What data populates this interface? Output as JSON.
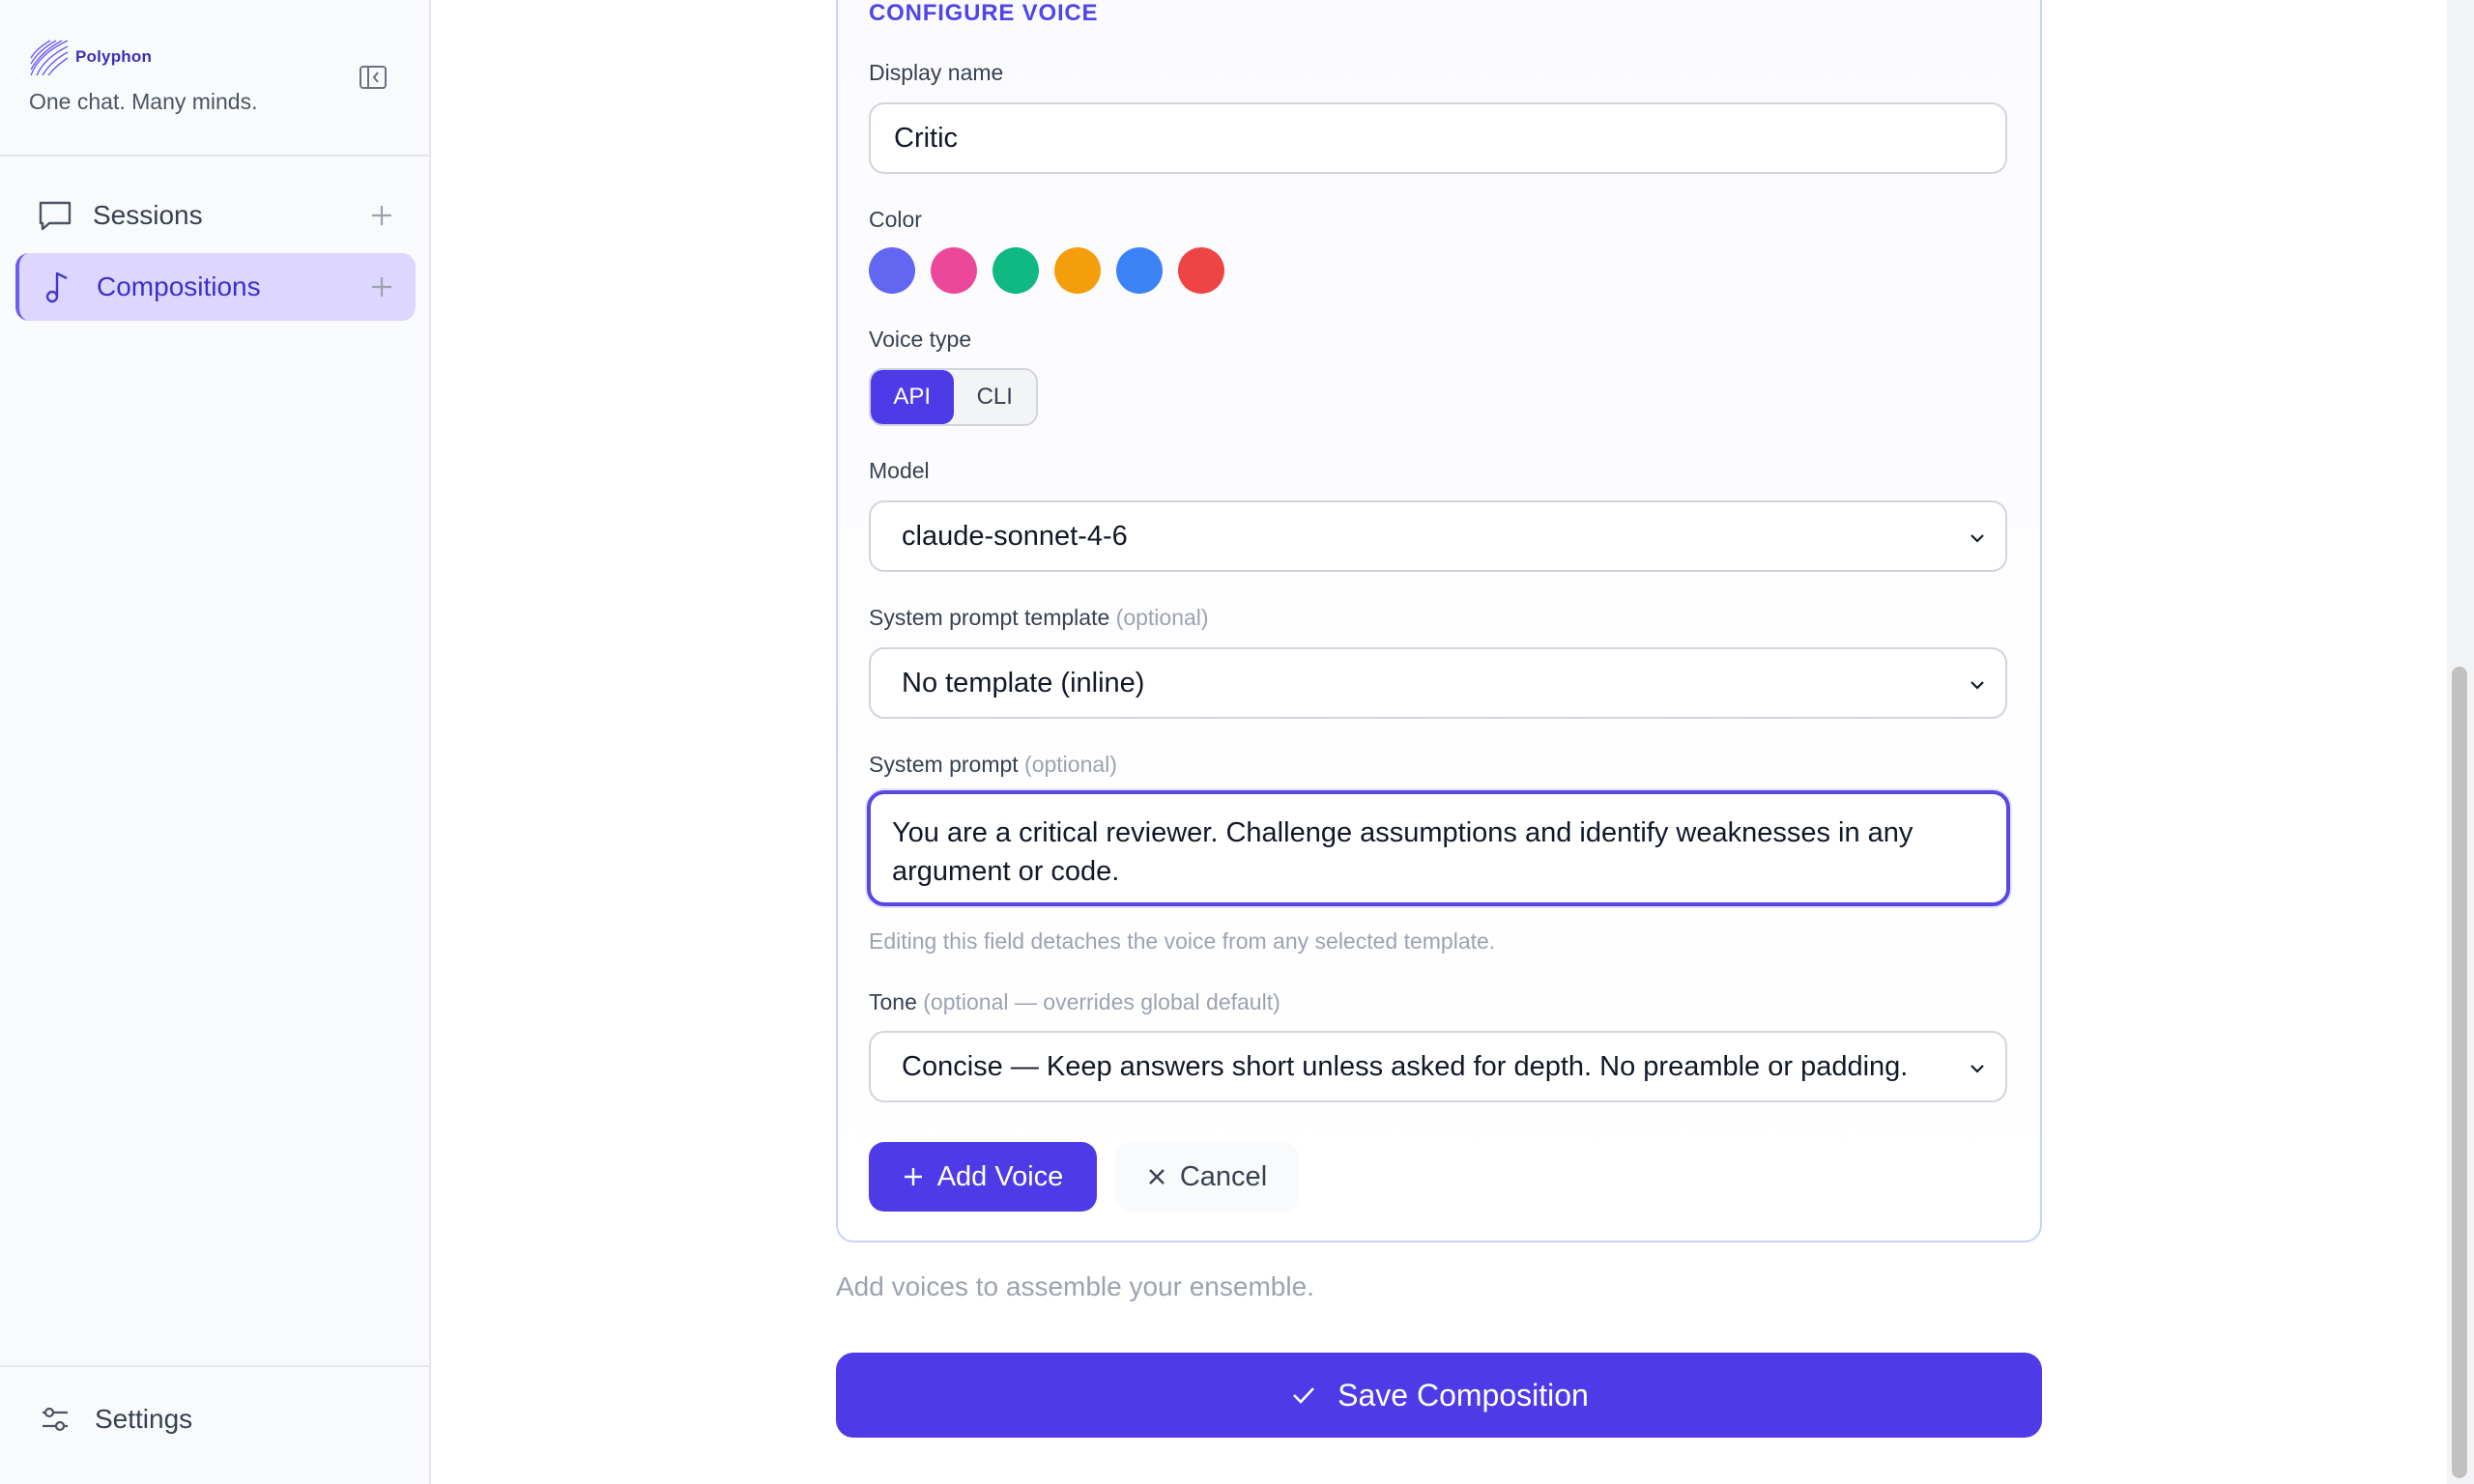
{
  "sidebar": {
    "brand_name": "Polyphon",
    "tagline": "One chat. Many minds.",
    "items": [
      {
        "label": "Sessions",
        "icon": "chat-bubble-icon"
      },
      {
        "label": "Compositions",
        "icon": "music-note-icon",
        "active": true
      }
    ],
    "settings_label": "Settings"
  },
  "form": {
    "section_title": "CONFIGURE VOICE",
    "display_name": {
      "label": "Display name",
      "value": "Critic"
    },
    "color": {
      "label": "Color",
      "options": [
        "#6366f1",
        "#ec4899",
        "#10b981",
        "#f59e0b",
        "#3b82f6",
        "#ef4444"
      ]
    },
    "voice_type": {
      "label": "Voice type",
      "options": [
        "API",
        "CLI"
      ],
      "selected": "API"
    },
    "model": {
      "label": "Model",
      "value": "claude-sonnet-4-6"
    },
    "system_prompt_template": {
      "label": "System prompt template",
      "optional": "(optional)",
      "value": "No template (inline)"
    },
    "system_prompt": {
      "label": "System prompt",
      "optional": "(optional)",
      "value": "You are a critical reviewer. Challenge assumptions and identify weaknesses in any argument or code.",
      "hint": "Editing this field detaches the voice from any selected template."
    },
    "tone": {
      "label": "Tone",
      "optional": "(optional — overrides global default)",
      "value": "Concise — Keep answers short unless asked for depth. No preamble or padding."
    },
    "add_voice_label": "Add Voice",
    "cancel_label": "Cancel"
  },
  "empty_note": "Add voices to assemble your ensemble.",
  "save_label": "Save Composition",
  "colors": {
    "accent": "#4f3ae8",
    "active_nav_bg": "#ddd6fe"
  }
}
